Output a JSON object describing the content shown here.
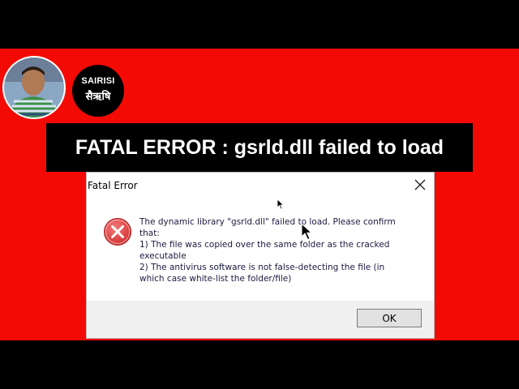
{
  "channel": {
    "name_en": "SAIRISI",
    "name_hi": "सैऋषि"
  },
  "headline": {
    "text": "FATAL ERROR : gsrld.dll failed to load"
  },
  "dialog": {
    "title": "Fatal Error",
    "close_icon": "close-icon",
    "message": "The dynamic library \"gsrld.dll\" failed to load. Please confirm\nthat:\n1) The file was copied over the same folder as the cracked\nexecutable\n2) The antivirus software is not false-detecting the file (in\nwhich case white-list the folder/file)",
    "ok_label": "OK"
  },
  "colors": {
    "background_red": "#f40a05",
    "letterbox": "#000000",
    "error_icon_red": "#e23b3b"
  }
}
